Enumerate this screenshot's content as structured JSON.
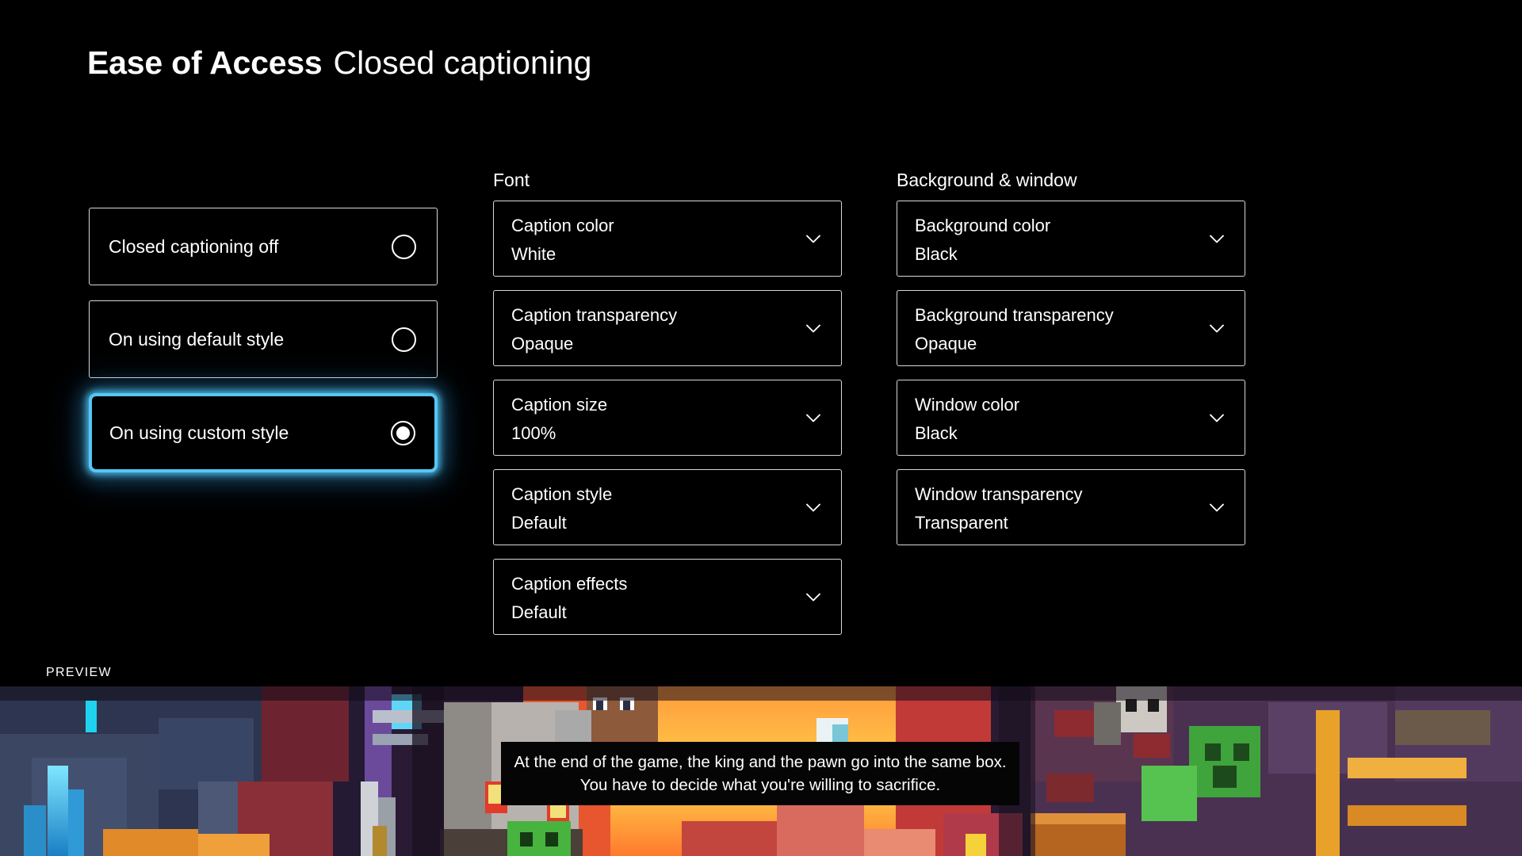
{
  "header": {
    "app_section": "Ease of Access",
    "page_title": "Closed captioning"
  },
  "mode_options": [
    {
      "label": "Closed captioning off",
      "selected": false
    },
    {
      "label": "On using default style",
      "selected": false
    },
    {
      "label": "On using custom style",
      "selected": true
    }
  ],
  "font_group": {
    "title": "Font",
    "settings": [
      {
        "label": "Caption color",
        "value": "White"
      },
      {
        "label": "Caption transparency",
        "value": "Opaque"
      },
      {
        "label": "Caption size",
        "value": "100%"
      },
      {
        "label": "Caption style",
        "value": "Default"
      },
      {
        "label": "Caption effects",
        "value": "Default"
      }
    ]
  },
  "background_group": {
    "title": "Background & window",
    "settings": [
      {
        "label": "Background color",
        "value": "Black"
      },
      {
        "label": "Background transparency",
        "value": "Opaque"
      },
      {
        "label": "Window color",
        "value": "Black"
      },
      {
        "label": "Window transparency",
        "value": "Transparent"
      }
    ]
  },
  "preview": {
    "label": "PREVIEW",
    "caption_line1": "At the end of the game, the king and the pawn go into the same box.",
    "caption_line2": "You have to decide what you're willing to sacrifice."
  },
  "colors": {
    "focus_accent": "#55c7f5",
    "border": "#d8d8d8",
    "background": "#000000",
    "text": "#ffffff"
  }
}
